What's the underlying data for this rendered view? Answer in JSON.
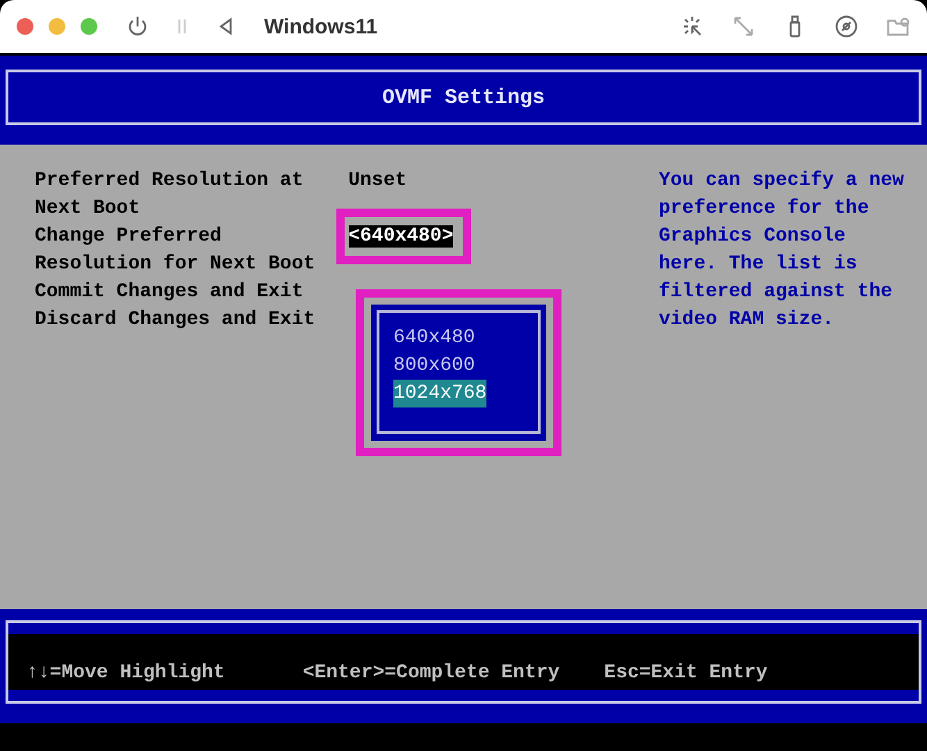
{
  "window": {
    "title": "Windows11"
  },
  "header": {
    "title": "OVMF Settings"
  },
  "settings": [
    {
      "label": "Preferred Resolution at Next Boot",
      "value": {
        "text": "Unset",
        "selected": false,
        "annotated": false
      }
    },
    {
      "label": "Change Preferred Resolution for Next Boot",
      "value": {
        "text": "<640x480>",
        "selected": true,
        "annotated": true
      }
    },
    {
      "label": "Commit Changes and Exit"
    },
    {
      "label": "Discard Changes and Exit"
    }
  ],
  "help": "You can specify a new preference for the Graphics Console here. The list is filtered against the video RAM size.",
  "popup": {
    "annotated": true,
    "options": [
      {
        "label": "640x480",
        "selected": false
      },
      {
        "label": "800x600",
        "selected": false
      },
      {
        "label": "1024x768",
        "selected": true
      }
    ]
  },
  "footer": [
    "↑↓=Move Highlight",
    "<Enter>=Complete Entry",
    "Esc=Exit Entry"
  ]
}
